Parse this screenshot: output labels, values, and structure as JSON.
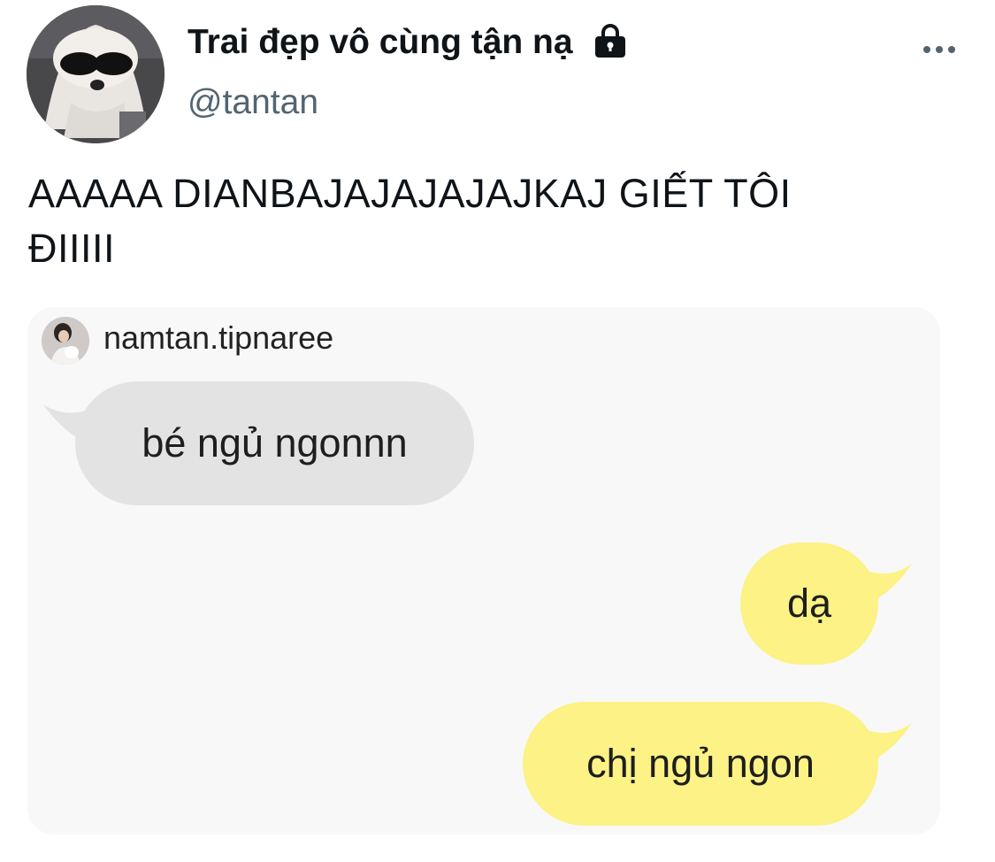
{
  "header": {
    "display_name": "Trai đẹp vô cùng tận nạ",
    "handle": "@tantan",
    "icons": [
      "lock-icon",
      "more-icon"
    ]
  },
  "tweet": {
    "text_line_1": "AAAAA DIANBAJAJAJAJAJKAJ GIẾT TÔI",
    "text_line_2": "ĐIIIII"
  },
  "chat": {
    "username": "namtan.tipnaree",
    "messages": [
      {
        "text": "bé ngủ ngonnn",
        "side": "left"
      },
      {
        "text": "dạ",
        "side": "right"
      },
      {
        "text": "chị ngủ ngon",
        "side": "right"
      }
    ]
  },
  "colors": {
    "text": "#0f1419",
    "handle": "#536471",
    "incoming_bubble": "#e3e3e3",
    "outgoing_bubble": "#fcf285",
    "media_background": "#f8f8f8"
  }
}
